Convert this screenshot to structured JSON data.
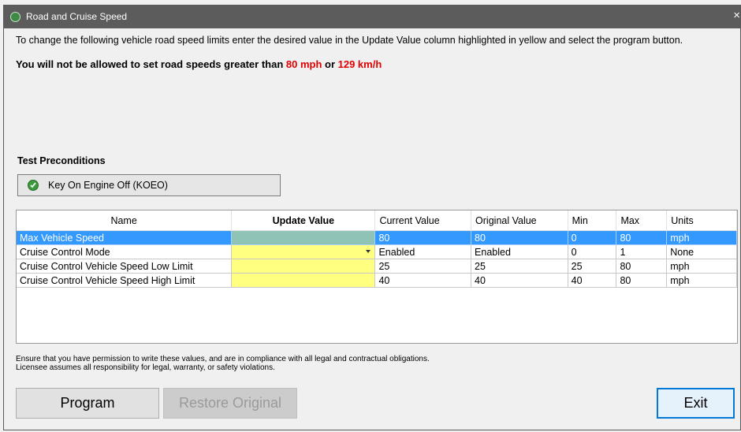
{
  "window": {
    "title": "Road and Cruise Speed",
    "close_glyph": "×"
  },
  "instructions": "To change the following vehicle road speed limits enter the desired value in the Update Value column highlighted in yellow and select the program button.",
  "warning": {
    "prefix": "You will not be allowed to set road speeds greater than ",
    "mph": "80 mph",
    "middle": " or ",
    "kmh": "129 km/h"
  },
  "preconditions": {
    "heading": "Test Preconditions",
    "items": [
      {
        "label": "Key On Engine Off (KOEO)",
        "icon": "check-circle-icon",
        "status": "passed"
      }
    ]
  },
  "table": {
    "columns": [
      "Name",
      "Update Value",
      "Current Value",
      "Original Value",
      "Min",
      "Max",
      "Units"
    ],
    "rows": [
      {
        "name": "Max Vehicle Speed",
        "update": "",
        "current": "80",
        "original": "80",
        "min": "0",
        "max": "80",
        "units": "mph",
        "selected": true
      },
      {
        "name": "Cruise Control Mode",
        "update": "",
        "current": "Enabled",
        "original": "Enabled",
        "min": "0",
        "max": "1",
        "units": "None",
        "dropdown": true
      },
      {
        "name": "Cruise Control Vehicle Speed Low Limit",
        "update": "",
        "current": "25",
        "original": "25",
        "min": "25",
        "max": "80",
        "units": "mph"
      },
      {
        "name": "Cruise Control Vehicle Speed High Limit",
        "update": "",
        "current": "40",
        "original": "40",
        "min": "40",
        "max": "80",
        "units": "mph"
      }
    ]
  },
  "disclaimer": [
    "Ensure that you have permission to write these values, and are in compliance with all legal and contractual obligations.",
    "Licensee assumes all responsibility for legal, warranty, or safety violations."
  ],
  "buttons": {
    "program": "Program",
    "restore": "Restore Original",
    "exit": "Exit"
  },
  "colors": {
    "accent": "#0078d7",
    "selection": "#3399ff",
    "update_cell": "#ffff80",
    "warning_red": "#e00000"
  }
}
